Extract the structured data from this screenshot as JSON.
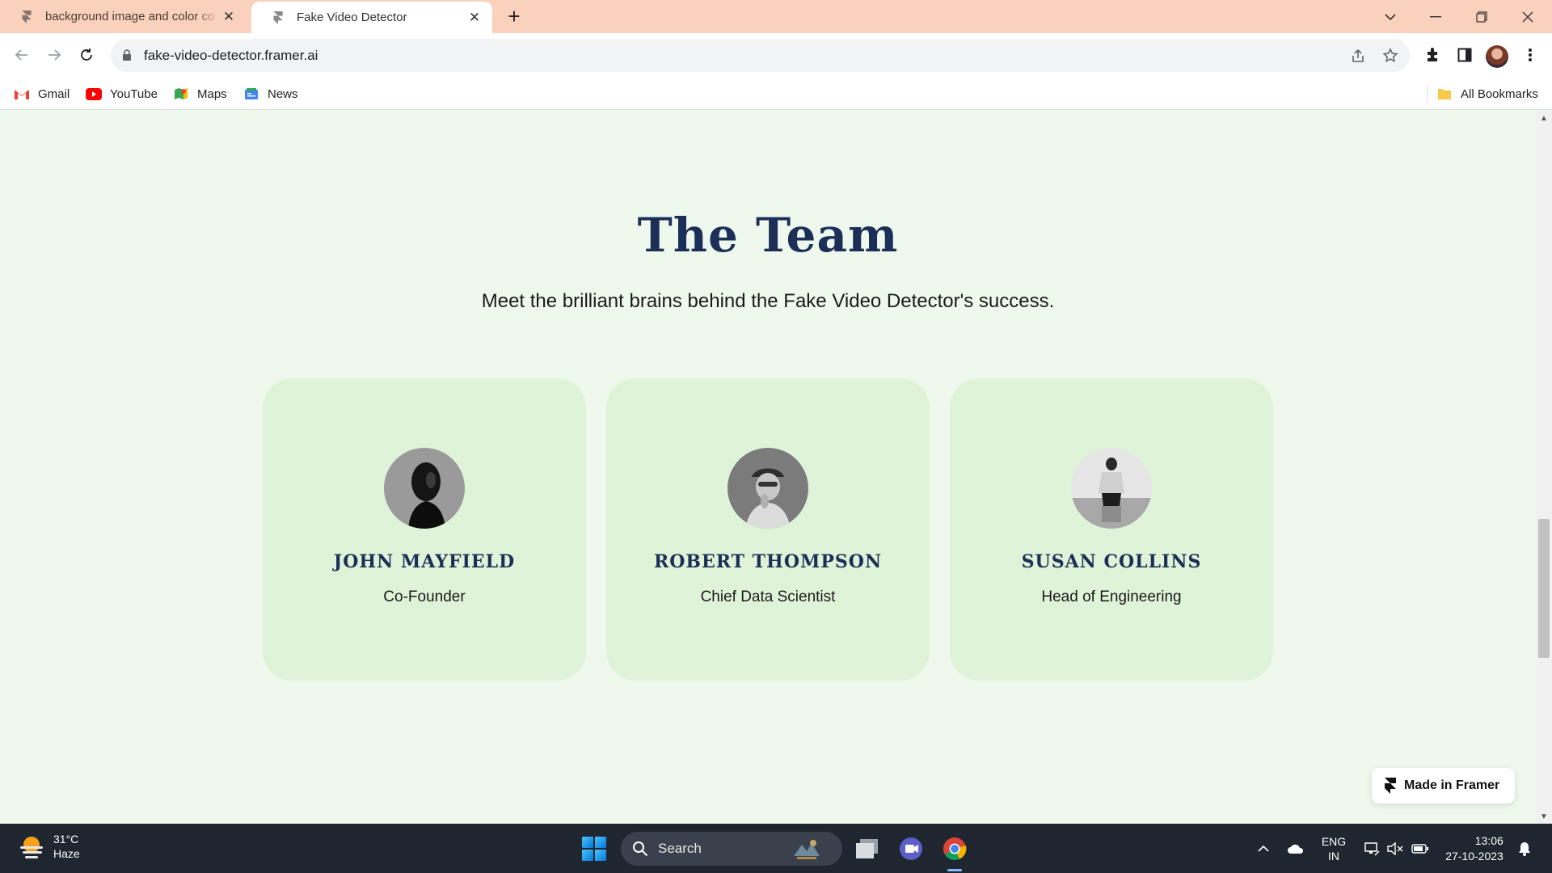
{
  "browser": {
    "tabs": [
      {
        "title": "background image and color co",
        "active": false
      },
      {
        "title": "Fake Video Detector",
        "active": true
      }
    ],
    "url": "fake-video-detector.framer.ai",
    "bookmarks": [
      {
        "label": "Gmail",
        "icon": "gmail-icon"
      },
      {
        "label": "YouTube",
        "icon": "youtube-icon"
      },
      {
        "label": "Maps",
        "icon": "maps-icon"
      },
      {
        "label": "News",
        "icon": "news-icon"
      }
    ],
    "all_bookmarks": "All Bookmarks"
  },
  "page": {
    "heading": "The Team",
    "subheading": "Meet the brilliant brains behind the Fake Video Detector's success.",
    "team": [
      {
        "name": "JOHN MAYFIELD",
        "role": "Co-Founder"
      },
      {
        "name": "ROBERT THOMPSON",
        "role": "Chief Data Scientist"
      },
      {
        "name": "SUSAN COLLINS",
        "role": "Head of Engineering"
      }
    ],
    "badge": "Made in Framer"
  },
  "taskbar": {
    "weather_temp": "31°C",
    "weather_desc": "Haze",
    "search": "Search",
    "lang_top": "ENG",
    "lang_bottom": "IN",
    "time": "13:06",
    "date": "27-10-2023"
  },
  "colors": {
    "page_bg": "#eff8ed",
    "card_bg": "#dff3d8",
    "heading": "#1b2f57",
    "tabstrip": "#fad1bc",
    "taskbar": "#1f2630"
  }
}
